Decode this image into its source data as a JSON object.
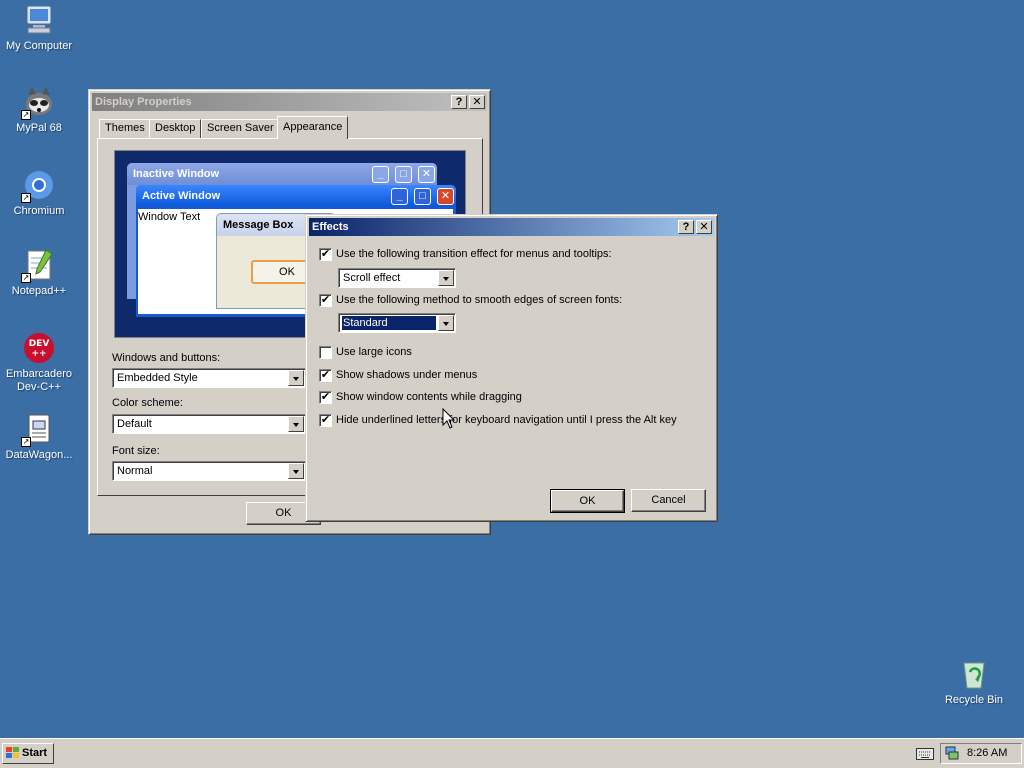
{
  "desktop": {
    "icons": [
      {
        "label": "My Computer",
        "icon": "my-computer-icon"
      },
      {
        "label": "MyPal 68",
        "icon": "mypal-icon"
      },
      {
        "label": "Chromium",
        "icon": "chromium-icon"
      },
      {
        "label": "Notepad++",
        "icon": "notepad-plus-plus-icon"
      },
      {
        "label": "Embarcadero Dev-C++",
        "icon": "devcpp-icon"
      },
      {
        "label": "DataWagon...",
        "icon": "datawagon-icon"
      },
      {
        "label": "Recycle Bin",
        "icon": "recycle-bin-icon"
      }
    ]
  },
  "display_properties": {
    "title": "Display Properties",
    "tabs": [
      "Themes",
      "Desktop",
      "Screen Saver",
      "Appearance"
    ],
    "selected_tab": "Appearance",
    "preview": {
      "inactive_title": "Inactive Window",
      "active_title": "Active Window",
      "window_text": "Window Text",
      "message_box_title": "Message Box",
      "ok_label": "OK"
    },
    "windows_buttons_label": "Windows and buttons:",
    "windows_buttons_value": "Embedded Style",
    "color_scheme_label": "Color scheme:",
    "color_scheme_value": "Default",
    "font_size_label": "Font size:",
    "font_size_value": "Normal",
    "ok_label": "OK"
  },
  "effects": {
    "title": "Effects",
    "transition_label": "Use the following transition effect for menus and tooltips:",
    "transition_checked": true,
    "transition_value": "Scroll effect",
    "smooth_label": "Use the following method to smooth edges of screen fonts:",
    "smooth_checked": true,
    "smooth_value": "Standard",
    "large_icons_label": "Use large icons",
    "large_icons_checked": false,
    "shadows_label": "Show shadows under menus",
    "shadows_checked": true,
    "drag_label": "Show window contents while dragging",
    "drag_checked": true,
    "underline_label": "Hide underlined letters for keyboard navigation until I press the Alt key",
    "underline_checked": true,
    "ok_label": "OK",
    "cancel_label": "Cancel"
  },
  "taskbar": {
    "start_label": "Start",
    "clock": "8:26 AM"
  },
  "colors": {
    "desktop": "#3b6ea5",
    "face": "#d4d0c8",
    "active_title": "#0a246a"
  }
}
